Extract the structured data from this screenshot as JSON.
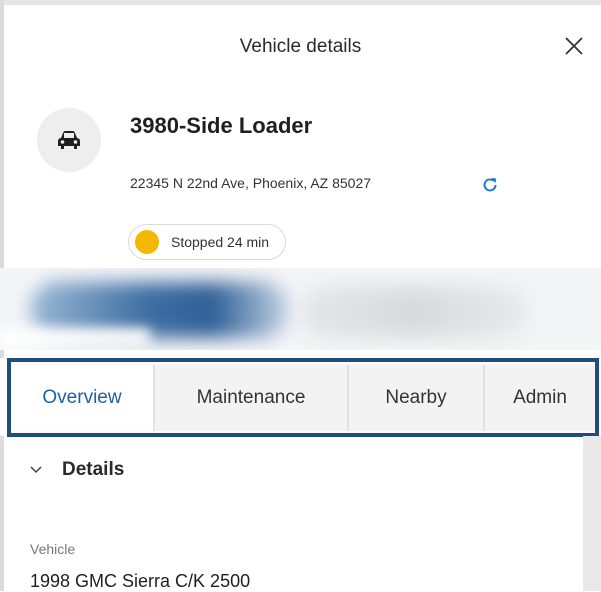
{
  "header": {
    "title": "Vehicle details"
  },
  "vehicle": {
    "name": "3980-Side Loader",
    "address": "22345 N 22nd Ave, Phoenix, AZ 85027",
    "status": {
      "text": "Stopped 24 min",
      "color": "#f2b900"
    }
  },
  "tabs": [
    {
      "label": "Overview",
      "active": true
    },
    {
      "label": "Maintenance",
      "active": false
    },
    {
      "label": "Nearby",
      "active": false
    },
    {
      "label": "Admin",
      "active": false
    }
  ],
  "details": {
    "section_label": "Details",
    "field_label": "Vehicle",
    "field_value": "1998 GMC Sierra C/K 2500"
  },
  "colors": {
    "accent": "#1f5fa6",
    "highlight_border": "#1f4e7a",
    "refresh_icon": "#1f78d1"
  },
  "icons": {
    "close": "close-icon",
    "vehicle": "car-icon",
    "refresh": "refresh-icon",
    "chevron": "chevron-down-icon"
  }
}
